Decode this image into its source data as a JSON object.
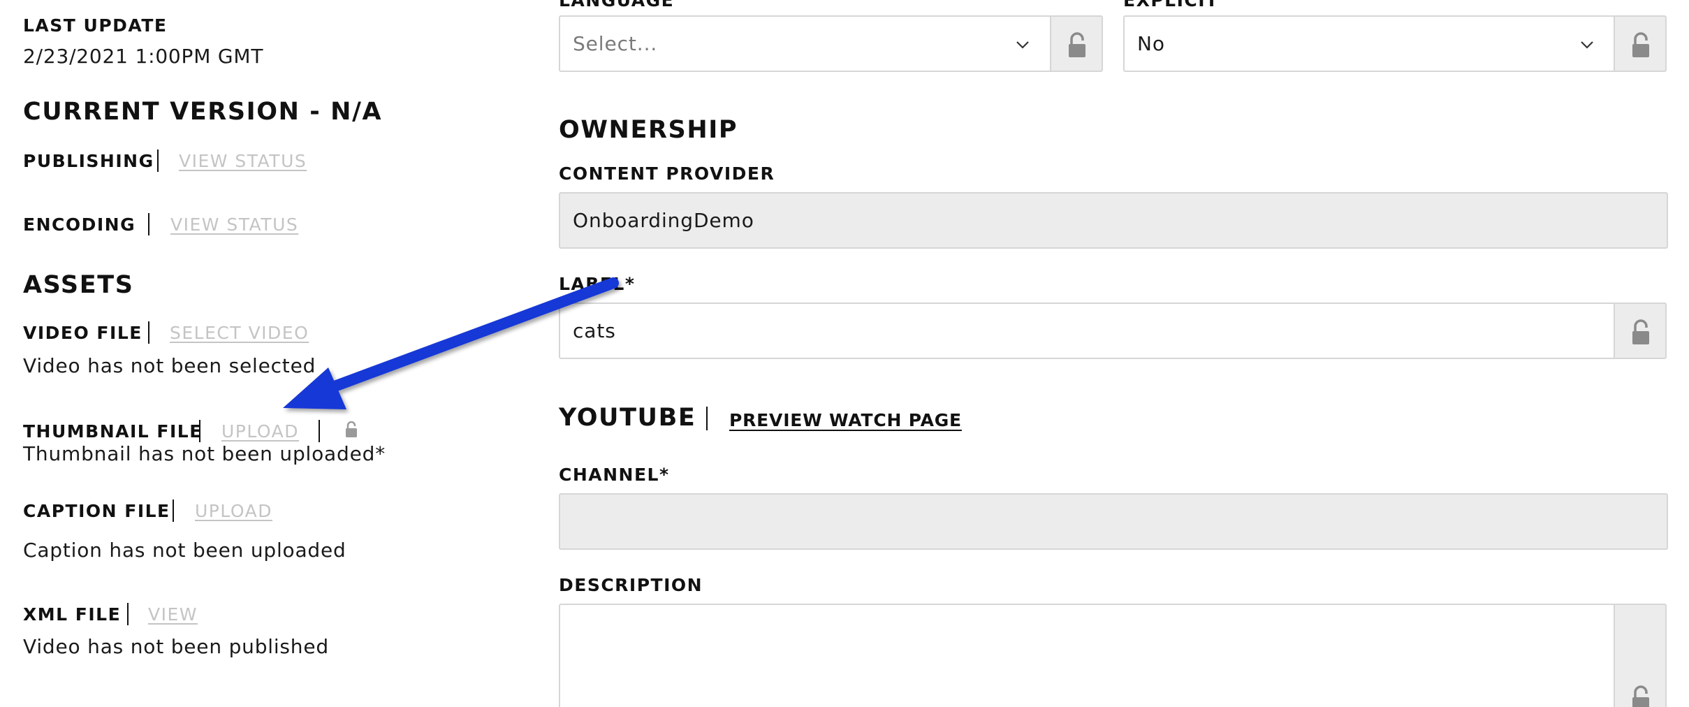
{
  "left": {
    "last_update_label": "LAST UPDATE",
    "last_update_value": "2/23/2021 1:00PM GMT",
    "current_version_title": "CURRENT VERSION - N/A",
    "publishing_label": "PUBLISHING",
    "publishing_link": "VIEW STATUS",
    "encoding_label": "ENCODING",
    "encoding_link": "VIEW STATUS",
    "assets_title": "ASSETS",
    "video_file_label": "VIDEO FILE",
    "video_file_link": "SELECT VIDEO",
    "video_file_status": "Video has not been selected",
    "thumbnail_file_label": "THUMBNAIL FILE",
    "thumbnail_file_link": "UPLOAD",
    "thumbnail_file_status": "Thumbnail has not been uploaded*",
    "caption_file_label": "CAPTION FILE",
    "caption_file_link": "UPLOAD",
    "caption_file_status": "Caption has not been uploaded",
    "xml_file_label": "XML FILE",
    "xml_file_link": "VIEW",
    "xml_file_status": "Video has not been published"
  },
  "right": {
    "language_label": "LANGUAGE",
    "language_placeholder": "Select...",
    "explicit_label": "EXPLICIT",
    "explicit_value": "No",
    "ownership_title": "OWNERSHIP",
    "content_provider_label": "CONTENT PROVIDER",
    "content_provider_value": "OnboardingDemo",
    "label_label": "LABEL*",
    "label_value": "cats",
    "youtube_title": "YOUTUBE",
    "preview_link": "PREVIEW WATCH PAGE",
    "channel_label": "CHANNEL*",
    "channel_value": "",
    "description_label": "DESCRIPTION",
    "description_value": ""
  },
  "annotation": {
    "arrow_color": "#1638d6"
  },
  "icons": {
    "lock": "lock-icon",
    "dropdown": "chevron-down-icon"
  }
}
